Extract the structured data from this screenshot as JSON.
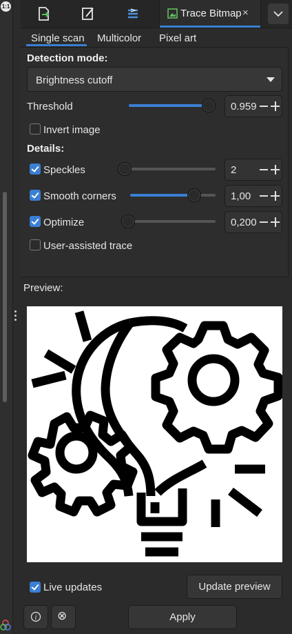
{
  "left_strip": {
    "zoom_badge": "1:1"
  },
  "tabs": {
    "icons": [
      "export-icon",
      "xml-editor-icon",
      "layers-icon"
    ],
    "active": {
      "label": "Trace Bitmap",
      "close": "×"
    }
  },
  "subtabs": [
    "Single scan",
    "Multicolor",
    "Pixel art"
  ],
  "detection": {
    "heading": "Detection mode:",
    "selected": "Brightness cutoff"
  },
  "threshold": {
    "label": "Threshold",
    "value": "0.959",
    "level": 0.959
  },
  "invert": {
    "label": "Invert image",
    "checked": false
  },
  "details": {
    "heading": "Details:",
    "speckles": {
      "label": "Speckles",
      "checked": true,
      "value": "2",
      "level": 0.0
    },
    "smooth": {
      "label": "Smooth corners",
      "checked": true,
      "value": "1,00",
      "level": 0.74
    },
    "optimize": {
      "label": "Optimize",
      "checked": true,
      "value": "0,200",
      "level": 0.0
    },
    "user_assisted": {
      "label": "User-assisted trace",
      "checked": false
    }
  },
  "preview": {
    "label": "Preview:"
  },
  "footer": {
    "live_updates": {
      "label": "Live updates",
      "checked": true
    },
    "update_preview": "Update preview",
    "info_icon": "i",
    "reset_icon": "⊗",
    "apply": "Apply"
  },
  "colors": {
    "accent": "#3a7fd4",
    "panel": "#2b2b2b"
  }
}
